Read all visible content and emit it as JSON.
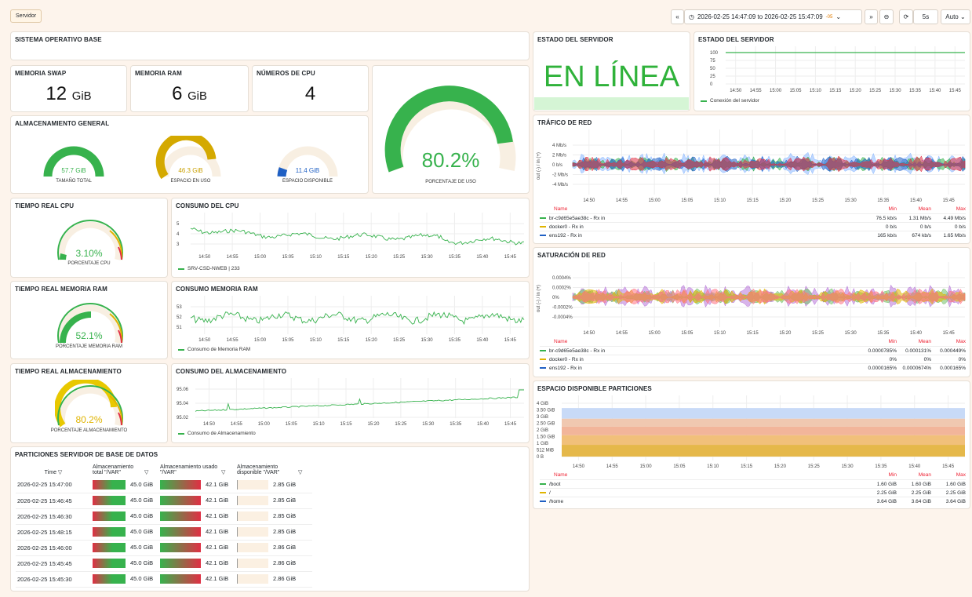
{
  "topbar": {
    "tag": "Servidor",
    "back": "«",
    "time_range": "2026-02-25 14:47:09 to 2026-02-25 15:47:09",
    "tz": "-05",
    "fwd": "»",
    "refresh": "5s",
    "auto": "Auto"
  },
  "titles": {
    "so": "SISTEMA OPERATIVO BASE",
    "swap": "MEMORIA SWAP",
    "ram": "MEMORIA RAM",
    "cpus": "NÚMEROS DE CPU",
    "storage": "ALMACENAMIENTO GENERAL",
    "rt_cpu": "TIEMPO REAL CPU",
    "cons_cpu": "CONSUMO DEL CPU",
    "rt_ram": "TIEMPO REAL MEMORIA RAM",
    "cons_ram": "CONSUMO MEMORIA RAM",
    "rt_disk": "TIEMPO REAL ALMACENAMIENTO",
    "cons_disk": "CONSUMO DEL ALMACENAMIENTO",
    "parts": "PARTICIONES SERVIDOR DE BASE DE DATOS",
    "estado1": "ESTADO DEL SERVIDOR",
    "estado2": "ESTADO DEL SERVIDOR",
    "trafico": "TRÁFICO DE RED",
    "saturacion": "SATURACIÓN DE RED",
    "espacio": "ESPACIO DISPONIBLE PARTICIONES"
  },
  "stats": {
    "swap_value": "12",
    "swap_unit": "GiB",
    "ram_value": "6",
    "ram_unit": "GiB",
    "cpus_value": "4",
    "total_value": "57.7 GiB",
    "total_label": "TAMAÑO TOTAL",
    "used_value": "46.3 GiB",
    "used_label": "ESPACIO EN USO",
    "free_value": "11.4 GiB",
    "free_label": "ESPACIO DISPONIBLE",
    "usage_pct": "80.2%",
    "usage_label": "PORCENTAJE DE USO",
    "usage_fraction": 0.802,
    "cpu_pct": "3.10%",
    "cpu_label": "PORCENTAJE CPU",
    "cpu_fraction": 0.031,
    "ram_pct": "52.1%",
    "ram_label": "PORCENTAJE MEMORIA RAM",
    "ram_fraction": 0.521,
    "disk_pct": "80.2%",
    "disk_label": "PORCENTAJE ALMACENAMIENTO",
    "disk_fraction": 0.802,
    "status": "EN LÍNEA"
  },
  "colors": {
    "green": "#37b24d",
    "yellow": "#e0b400",
    "blue": "#1f60c4",
    "red": "#e02f44",
    "status_bg": "#d5f5d5"
  },
  "time_ticks": [
    "14:50",
    "14:55",
    "15:00",
    "15:05",
    "15:10",
    "15:15",
    "15:20",
    "15:25",
    "15:30",
    "15:35",
    "15:40",
    "15:45"
  ],
  "cpu_chart": {
    "yticks": [
      "5",
      "4",
      "3"
    ],
    "legend": "SRV-CSD-NWEB | 233"
  },
  "ram_chart": {
    "yticks": [
      "53",
      "52",
      "51"
    ],
    "legend": "Consumo de Memoria RAM"
  },
  "disk_chart": {
    "yticks": [
      "95.06",
      "95.04",
      "95.02"
    ],
    "legend": "Consumo de Almacenamiento"
  },
  "estado_chart": {
    "yticks": [
      "100",
      "75",
      "50",
      "25",
      "0"
    ],
    "legend": "Conexión del servidor"
  },
  "trafico": {
    "yticks": [
      "4 Mb/s",
      "2 Mb/s",
      "0 b/s",
      "-2 Mb/s",
      "-4 Mb/s"
    ],
    "yaxis": "out (-) / in (+)",
    "hdr_name": "Name",
    "hdr": [
      "Min",
      "Mean",
      "Max"
    ],
    "rows": [
      {
        "name": "br-c9d65e5ae38c - Rx in",
        "color": "#37b24d",
        "v": [
          "76.5 kb/s",
          "1.31 Mb/s",
          "4.49 Mb/s"
        ]
      },
      {
        "name": "docker0 - Rx in",
        "color": "#e0b400",
        "v": [
          "0 b/s",
          "0 b/s",
          "0 b/s"
        ]
      },
      {
        "name": "ens192 - Rx in",
        "color": "#1f60c4",
        "v": [
          "165 kb/s",
          "674 kb/s",
          "1.65 Mb/s"
        ]
      }
    ]
  },
  "saturacion": {
    "yticks": [
      "0.0004%",
      "0.0002%",
      "0%",
      "-0.0002%",
      "-0.0004%"
    ],
    "yaxis": "out (-) / in (+)",
    "hdr_name": "Name",
    "hdr": [
      "Min",
      "Mean",
      "Max"
    ],
    "rows": [
      {
        "name": "br-c9d65e5ae38c - Rx in",
        "color": "#37b24d",
        "v": [
          "0.0000785%",
          "0.000131%",
          "0.000449%"
        ]
      },
      {
        "name": "docker0 - Rx in",
        "color": "#e0b400",
        "v": [
          "0%",
          "0%",
          "0%"
        ]
      },
      {
        "name": "ens192 - Rx in",
        "color": "#1f60c4",
        "v": [
          "0.0000165%",
          "0.0000674%",
          "0.000165%"
        ]
      }
    ]
  },
  "espacio": {
    "yticks": [
      "4 GiB",
      "3.50 GiB",
      "3 GiB",
      "2.50 GiB",
      "2 GiB",
      "1.50 GiB",
      "1 GiB",
      "512 MiB",
      "0 B"
    ],
    "hdr_name": "Name",
    "hdr": [
      "Min",
      "Mean",
      "Max"
    ],
    "rows": [
      {
        "name": "/boot",
        "color": "#37b24d",
        "v": [
          "1.60 GiB",
          "1.60 GiB",
          "1.60 GiB"
        ]
      },
      {
        "name": "/",
        "color": "#e0b400",
        "v": [
          "2.25 GiB",
          "2.25 GiB",
          "2.25 GiB"
        ]
      },
      {
        "name": "/home",
        "color": "#1f60c4",
        "v": [
          "3.64 GiB",
          "3.64 GiB",
          "3.64 GiB"
        ]
      }
    ]
  },
  "parts_table": {
    "headers": [
      "Time",
      "Almacenamiento total \"/VAR\"",
      "Almacenamiento usado \"/VAR\"",
      "Almacenamiento disponible \"/VAR\""
    ],
    "rows": [
      [
        "2026-02-25 15:47:00",
        "45.0 GiB",
        "42.1 GiB",
        "2.85 GiB"
      ],
      [
        "2026-02-25 15:46:45",
        "45.0 GiB",
        "42.1 GiB",
        "2.85 GiB"
      ],
      [
        "2026-02-25 15:46:30",
        "45.0 GiB",
        "42.1 GiB",
        "2.85 GiB"
      ],
      [
        "2026-02-25 15:48:15",
        "45.0 GiB",
        "42.1 GiB",
        "2.85 GiB"
      ],
      [
        "2026-02-25 15:46:00",
        "45.0 GiB",
        "42.1 GiB",
        "2.86 GiB"
      ],
      [
        "2026-02-25 15:45:45",
        "45.0 GiB",
        "42.1 GiB",
        "2.86 GiB"
      ],
      [
        "2026-02-25 15:45:30",
        "45.0 GiB",
        "42.1 GiB",
        "2.86 GiB"
      ]
    ]
  }
}
